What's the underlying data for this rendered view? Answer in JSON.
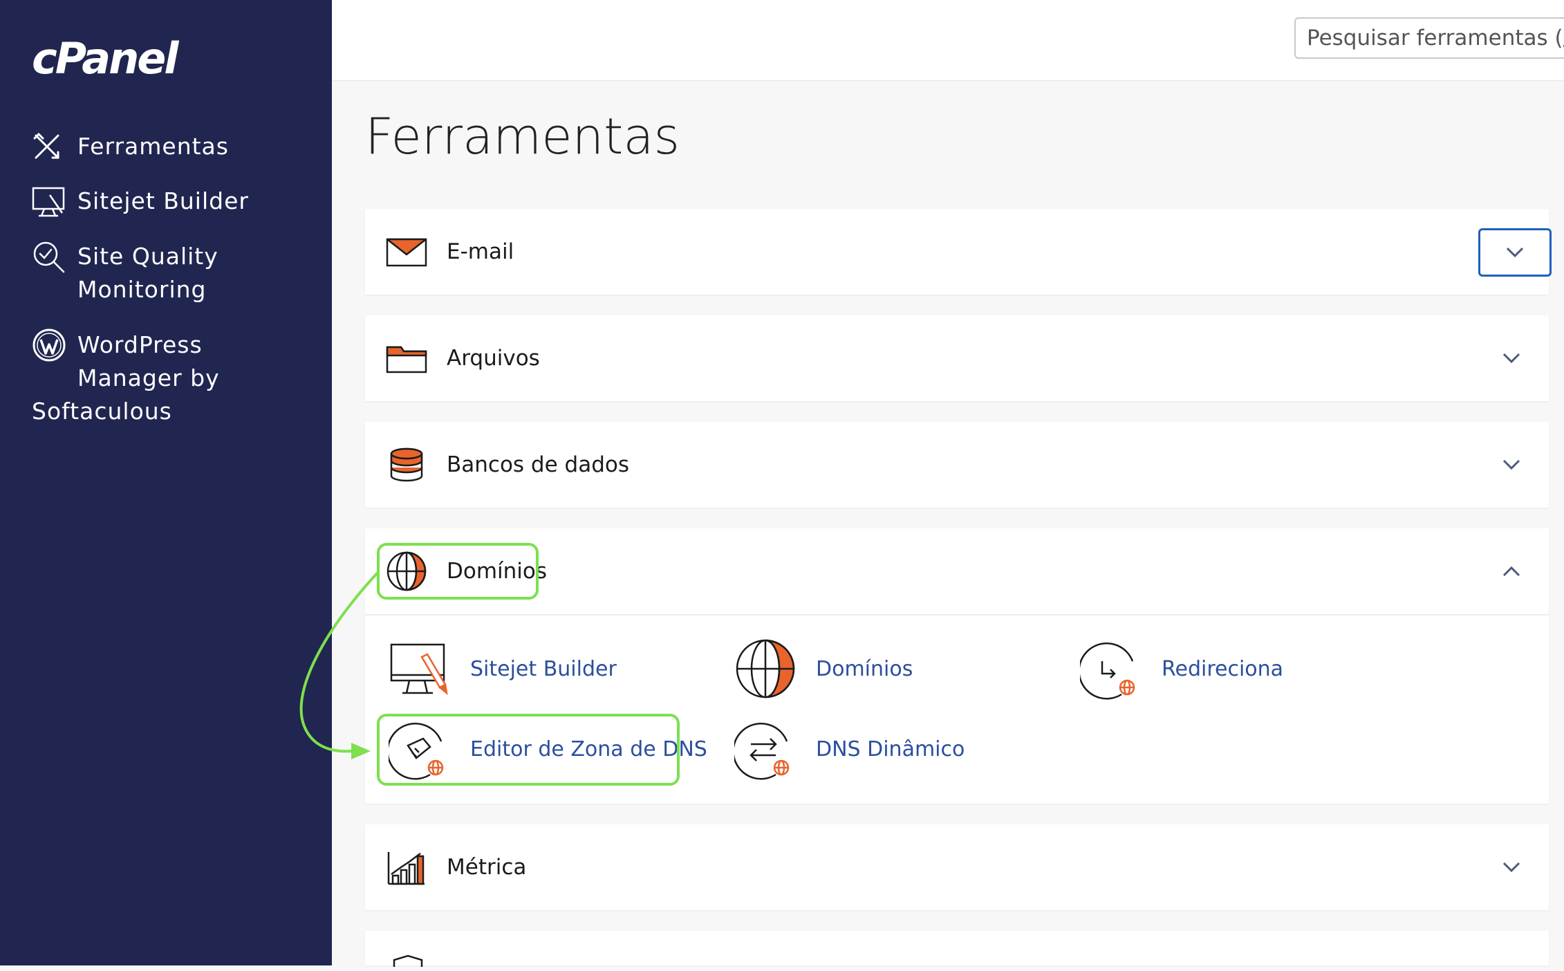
{
  "sidebar": {
    "logo": "cPanel",
    "items": [
      {
        "label": "Ferramentas",
        "icon": "tools-icon"
      },
      {
        "label": "Sitejet Builder",
        "icon": "monitor-brush-icon"
      },
      {
        "label": "Site Quality\nMonitoring",
        "icon": "magnifier-check-icon"
      },
      {
        "label": "WordPress\nManager by",
        "icon": "wordpress-icon"
      },
      {
        "label": "Softaculous"
      }
    ]
  },
  "header": {
    "search_placeholder": "Pesquisar ferramentas (/)"
  },
  "main": {
    "title": "Ferramentas",
    "sections": [
      {
        "title": "E-mail",
        "icon": "envelope-icon",
        "expanded": false
      },
      {
        "title": "Arquivos",
        "icon": "folder-icon",
        "expanded": false
      },
      {
        "title": "Bancos de dados",
        "icon": "database-icon",
        "expanded": false
      },
      {
        "title": "Domínios",
        "icon": "globe-icon",
        "expanded": true,
        "tools": [
          {
            "label": "Sitejet Builder",
            "icon": "monitor-brush-icon"
          },
          {
            "label": "Domínios",
            "icon": "globe-icon"
          },
          {
            "label": "Redireciona",
            "icon": "redirect-icon"
          },
          {
            "label": "Editor de Zona de DNS",
            "icon": "dns-zone-editor-icon"
          },
          {
            "label": "DNS Dinâmico",
            "icon": "dynamic-dns-icon"
          }
        ]
      },
      {
        "title": "Métrica",
        "icon": "bar-chart-icon",
        "expanded": false
      }
    ]
  },
  "colors": {
    "sidebar_bg": "#212650",
    "accent_orange": "#e8642c",
    "link_blue": "#2b4f9e",
    "highlight_green": "#7de04e",
    "focus_blue": "#1f5fbd"
  }
}
